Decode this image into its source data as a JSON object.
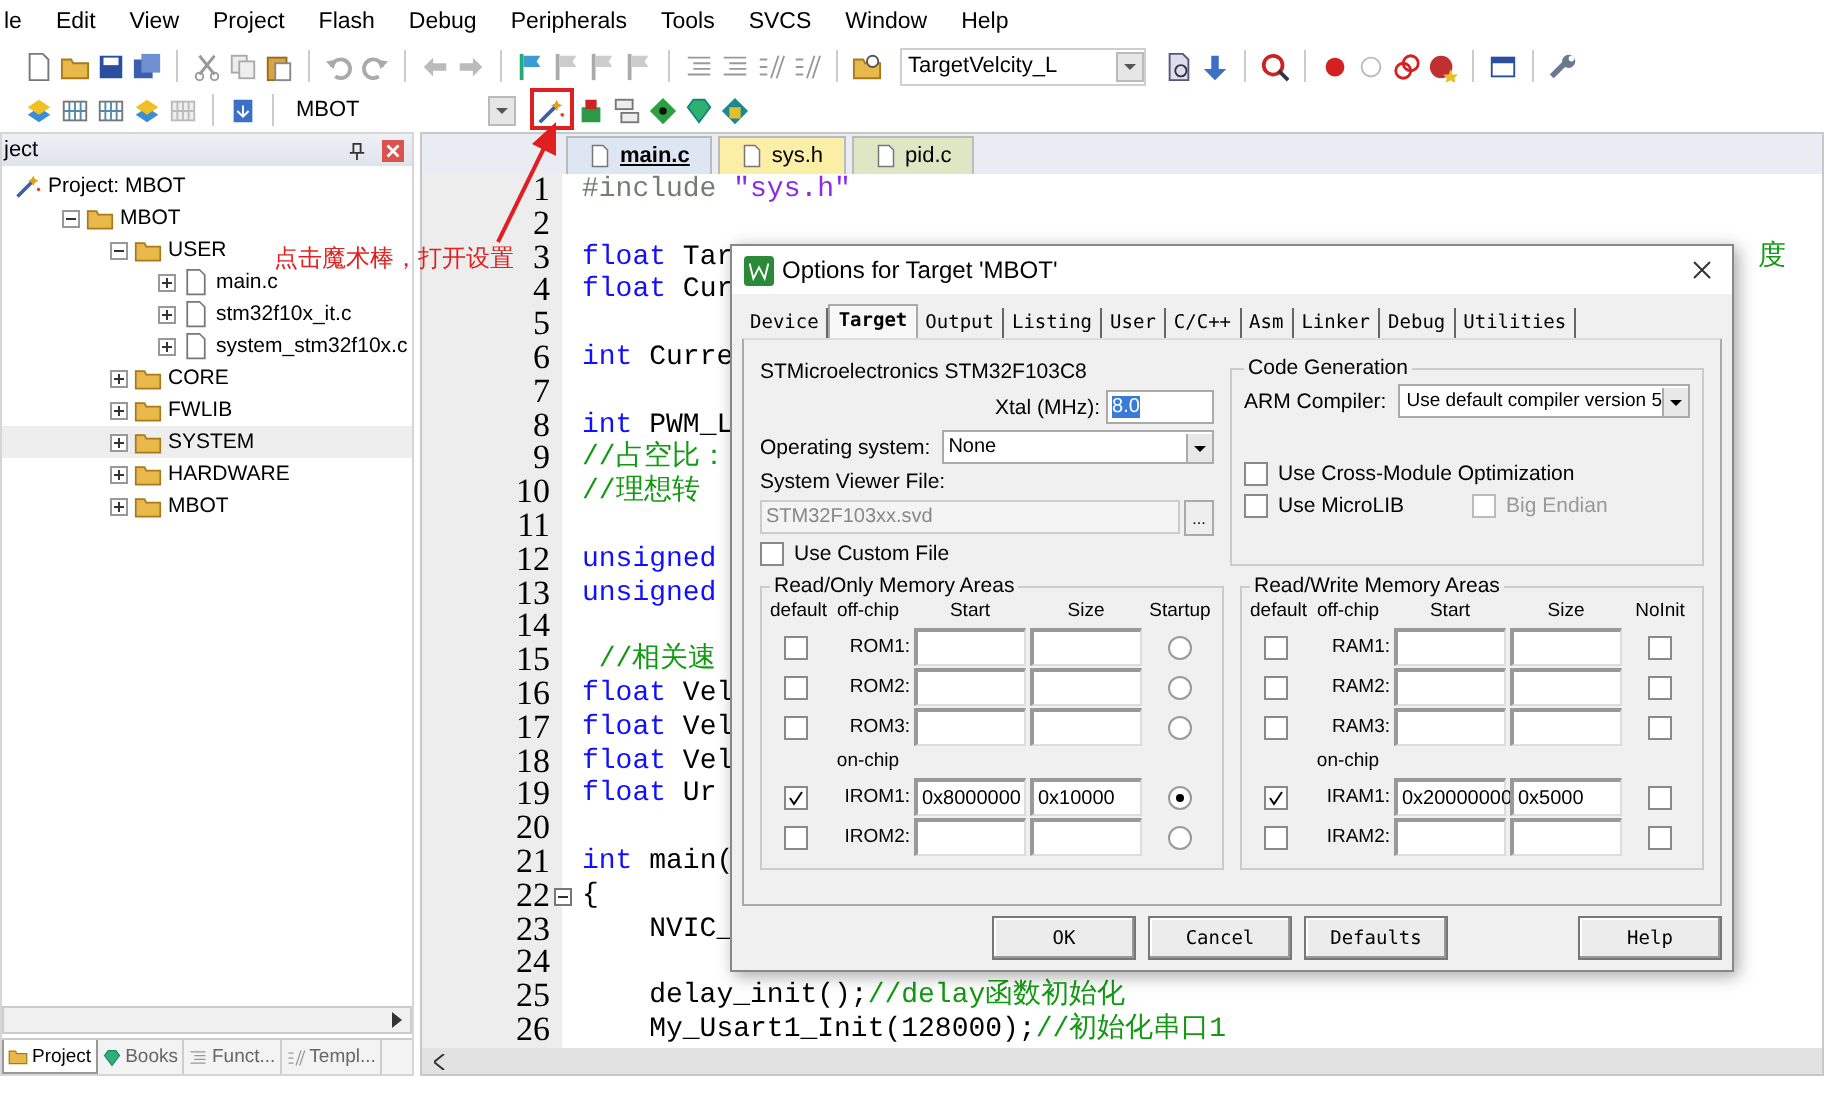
{
  "menu": [
    "le",
    "Edit",
    "View",
    "Project",
    "Flash",
    "Debug",
    "Peripherals",
    "Tools",
    "SVCS",
    "Window",
    "Help"
  ],
  "toolbar": {
    "target_combo": "TargetVelcity_L",
    "project_combo": "MBOT"
  },
  "project_panel": {
    "title": "ject",
    "tree": [
      {
        "label": "Project: MBOT",
        "kind": "root",
        "selected": false,
        "children": [
          {
            "label": "MBOT",
            "kind": "target",
            "expanded": true,
            "selected": false,
            "children": [
              {
                "label": "USER",
                "kind": "folder",
                "expanded": true,
                "selected": false,
                "children": [
                  {
                    "label": "main.c",
                    "kind": "file",
                    "expanded": false,
                    "selected": false
                  },
                  {
                    "label": "stm32f10x_it.c",
                    "kind": "file",
                    "expanded": false,
                    "selected": false
                  },
                  {
                    "label": "system_stm32f10x.c",
                    "kind": "file",
                    "expanded": false,
                    "selected": false
                  }
                ]
              },
              {
                "label": "CORE",
                "kind": "folder",
                "expanded": false,
                "selected": false
              },
              {
                "label": "FWLIB",
                "kind": "folder",
                "expanded": false,
                "selected": false
              },
              {
                "label": "SYSTEM",
                "kind": "folder",
                "expanded": false,
                "selected": true
              },
              {
                "label": "HARDWARE",
                "kind": "folder",
                "expanded": false,
                "selected": false
              },
              {
                "label": "MBOT",
                "kind": "folder",
                "expanded": false,
                "selected": false
              }
            ]
          }
        ]
      }
    ],
    "tabs": [
      {
        "label": "Project",
        "kind": "project",
        "selected": true
      },
      {
        "label": "Books",
        "kind": "books",
        "selected": false
      },
      {
        "label": "Funct...",
        "kind": "functions",
        "selected": false
      },
      {
        "label": "Templ...",
        "kind": "templates",
        "selected": false
      }
    ]
  },
  "editor": {
    "tabs": [
      {
        "label": "main.c",
        "selected": true,
        "color": "#dfe6f3"
      },
      {
        "label": "sys.h",
        "selected": false,
        "color": "#fbeea6"
      },
      {
        "label": "pid.c",
        "selected": false,
        "color": "#dde7c4"
      }
    ],
    "lines": [
      {
        "number": "1",
        "segments": [
          {
            "kind": "preproc",
            "text": "#include"
          },
          {
            "kind": "string",
            "text": " \"sys.h\""
          }
        ]
      },
      {
        "number": "2"
      },
      {
        "number": "3",
        "segments": [
          {
            "kind": "keyword",
            "text": "float"
          },
          {
            "kind": "plain",
            "text": " Tar"
          }
        ],
        "tail": "度"
      },
      {
        "number": "4",
        "segments": [
          {
            "kind": "keyword",
            "text": "float"
          },
          {
            "kind": "plain",
            "text": " Cur"
          }
        ]
      },
      {
        "number": "5"
      },
      {
        "number": "6",
        "segments": [
          {
            "kind": "keyword",
            "text": "int"
          },
          {
            "kind": "plain",
            "text": " Curre"
          }
        ]
      },
      {
        "number": "7"
      },
      {
        "number": "8",
        "segments": [
          {
            "kind": "keyword",
            "text": "int"
          },
          {
            "kind": "plain",
            "text": " PWM_L"
          }
        ]
      },
      {
        "number": "9",
        "segments": [
          {
            "kind": "comment",
            "text": "//占空比："
          }
        ]
      },
      {
        "number": "10",
        "segments": [
          {
            "kind": "comment",
            "text": "//理想转"
          }
        ]
      },
      {
        "number": "11"
      },
      {
        "number": "12",
        "segments": [
          {
            "kind": "keyword",
            "text": "unsigned"
          }
        ]
      },
      {
        "number": "13",
        "segments": [
          {
            "kind": "keyword",
            "text": "unsigned"
          }
        ]
      },
      {
        "number": "14"
      },
      {
        "number": "15",
        "segments": [
          {
            "kind": "comment",
            "text": " //相关速"
          }
        ]
      },
      {
        "number": "16",
        "segments": [
          {
            "kind": "keyword",
            "text": "float"
          },
          {
            "kind": "plain",
            "text": " Vel"
          }
        ]
      },
      {
        "number": "17",
        "segments": [
          {
            "kind": "keyword",
            "text": "float"
          },
          {
            "kind": "plain",
            "text": " Vel"
          }
        ]
      },
      {
        "number": "18",
        "segments": [
          {
            "kind": "keyword",
            "text": "float"
          },
          {
            "kind": "plain",
            "text": " Vel"
          }
        ]
      },
      {
        "number": "19",
        "segments": [
          {
            "kind": "keyword",
            "text": "float"
          },
          {
            "kind": "plain",
            "text": " Ur"
          }
        ]
      },
      {
        "number": "20"
      },
      {
        "number": "21",
        "segments": [
          {
            "kind": "keyword",
            "text": "int"
          },
          {
            "kind": "plain",
            "text": " main("
          }
        ]
      },
      {
        "number": "22",
        "segments": [
          {
            "kind": "plain",
            "text": "{"
          }
        ],
        "fold": true
      },
      {
        "number": "23",
        "segments": [
          {
            "kind": "plain",
            "text": "    NVIC_"
          }
        ]
      },
      {
        "number": "24"
      },
      {
        "number": "25",
        "segments": [
          {
            "kind": "plain",
            "text": "    delay_init();"
          },
          {
            "kind": "comment",
            "text": "//delay函数初始化"
          }
        ]
      },
      {
        "number": "26",
        "segments": [
          {
            "kind": "plain",
            "text": "    My_Usart1_Init(128000);"
          },
          {
            "kind": "comment",
            "text": "//初始化串口1"
          }
        ]
      }
    ]
  },
  "annotation": {
    "text": "点击魔术棒，打开设置"
  },
  "dialog": {
    "title": "Options for Target 'MBOT'",
    "tabs": [
      {
        "label": "Device",
        "selected": false
      },
      {
        "label": "Target",
        "selected": true
      },
      {
        "label": "Output",
        "selected": false
      },
      {
        "label": "Listing",
        "selected": false
      },
      {
        "label": "User",
        "selected": false
      },
      {
        "label": "C/C++",
        "selected": false
      },
      {
        "label": "Asm",
        "selected": false
      },
      {
        "label": "Linker",
        "selected": false
      },
      {
        "label": "Debug",
        "selected": false
      },
      {
        "label": "Utilities",
        "selected": false
      }
    ],
    "device": "STMicroelectronics STM32F103C8",
    "xtal": {
      "label": "Xtal (MHz):",
      "value": "8.0"
    },
    "os": {
      "label": "Operating system:",
      "value": "None"
    },
    "svd": {
      "label": "System Viewer File:",
      "value": "STM32F103xx.svd",
      "browse": "...",
      "disabled": true
    },
    "custom_file": {
      "label": "Use Custom File",
      "checked": false
    },
    "code_gen": {
      "title": "Code Generation",
      "compiler_label": "ARM Compiler:",
      "compiler": "Use default compiler version 5",
      "options": [
        {
          "label": "Use Cross-Module Optimization",
          "checked": false,
          "disabled": false
        },
        {
          "label": "Use MicroLIB",
          "checked": false,
          "disabled": false
        },
        {
          "label": "Big Endian",
          "checked": false,
          "disabled": true
        }
      ]
    },
    "rom": {
      "title": "Read/Only Memory Areas",
      "columns": [
        "default",
        "off-chip",
        "Start",
        "Size",
        "Startup"
      ],
      "on_chip_label": "on-chip",
      "off_chip_rows": [
        {
          "name": "ROM1:",
          "default": false,
          "flag": false
        },
        {
          "name": "ROM2:",
          "default": false,
          "flag": false
        },
        {
          "name": "ROM3:",
          "default": false,
          "flag": false
        }
      ],
      "on_chip_rows": [
        {
          "name": "IROM1:",
          "default": true,
          "start": "0x8000000",
          "size": "0x10000",
          "flag": true
        },
        {
          "name": "IROM2:",
          "default": false,
          "flag": false
        }
      ]
    },
    "ram": {
      "title": "Read/Write Memory Areas",
      "columns": [
        "default",
        "off-chip",
        "Start",
        "Size",
        "NoInit"
      ],
      "on_chip_label": "on-chip",
      "off_chip_rows": [
        {
          "name": "RAM1:",
          "default": false,
          "flag": false
        },
        {
          "name": "RAM2:",
          "default": false,
          "flag": false
        },
        {
          "name": "RAM3:",
          "default": false,
          "flag": false
        }
      ],
      "on_chip_rows": [
        {
          "name": "IRAM1:",
          "default": true,
          "start": "0x20000000",
          "size": "0x5000",
          "flag": false
        },
        {
          "name": "IRAM2:",
          "default": false,
          "flag": false
        }
      ]
    },
    "buttons": [
      "OK",
      "Cancel",
      "Defaults",
      "Help"
    ]
  }
}
